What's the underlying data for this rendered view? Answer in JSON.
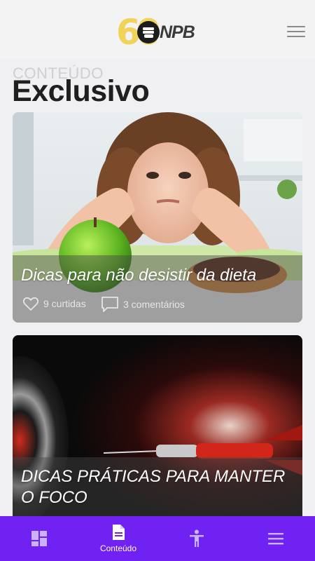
{
  "header": {
    "logo_number": "60",
    "logo_brand": "NPB"
  },
  "section": {
    "eyebrow": "CONTEÚDO",
    "title": "Exclusivo"
  },
  "cards": [
    {
      "title": "Dicas para não desistir da dieta",
      "likes": "9 curtidas",
      "comments": "3 comentários"
    },
    {
      "title": "DICAS PRÁTICAS PARA MANTER O FOCO"
    }
  ],
  "tabbar": {
    "active_label": "Conteúdo"
  },
  "colors": {
    "tabbar": "#6f22f2",
    "logo_yellow": "#f2d35a"
  }
}
